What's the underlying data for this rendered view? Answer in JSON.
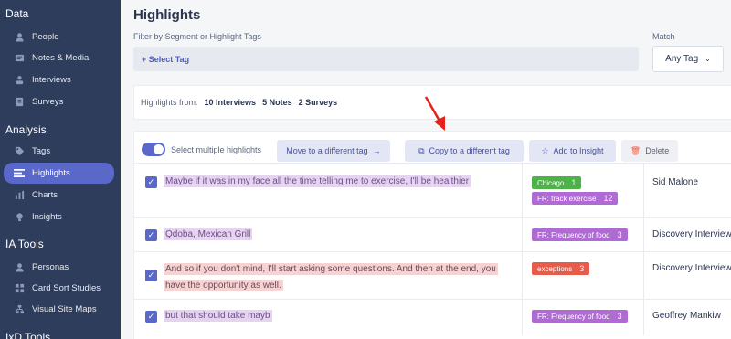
{
  "sidebar": {
    "sections": [
      {
        "title": "Data",
        "items": [
          {
            "label": "People",
            "icon": "people-icon"
          },
          {
            "label": "Notes & Media",
            "icon": "notes-icon"
          },
          {
            "label": "Interviews",
            "icon": "interviews-icon"
          },
          {
            "label": "Surveys",
            "icon": "surveys-icon"
          }
        ]
      },
      {
        "title": "Analysis",
        "items": [
          {
            "label": "Tags",
            "icon": "tag-icon"
          },
          {
            "label": "Highlights",
            "icon": "highlights-icon",
            "active": true
          },
          {
            "label": "Charts",
            "icon": "chart-icon"
          },
          {
            "label": "Insights",
            "icon": "bulb-icon"
          }
        ]
      },
      {
        "title": "IA Tools",
        "items": [
          {
            "label": "Personas",
            "icon": "persona-icon"
          },
          {
            "label": "Card Sort Studies",
            "icon": "card-sort-icon"
          },
          {
            "label": "Visual Site Maps",
            "icon": "sitemap-icon"
          }
        ]
      },
      {
        "title": "IxD Tools",
        "items": []
      }
    ]
  },
  "main": {
    "title": "Highlights",
    "filter_label": "Filter by Segment or Highlight Tags",
    "select_tag": "+ Select Tag",
    "match_label": "Match",
    "match_value": "Any Tag",
    "highlights_from": {
      "label": "Highlights from:",
      "interviews": "10 Interviews",
      "notes": "5 Notes",
      "surveys": "2 Surveys"
    },
    "toolbar": {
      "toggle_label": "Select multiple highlights",
      "move": "Move to a different tag",
      "copy": "Copy to a different tag",
      "add_insight": "Add to Insight",
      "delete": "Delete"
    },
    "rows": [
      {
        "text": "Maybe if it was in my face all the time telling me to exercise, I'll be healthier",
        "style": "purple",
        "tags": [
          {
            "label": "Chicago",
            "count": "1",
            "color": "green"
          },
          {
            "label": "FR: track exercise",
            "count": "12",
            "color": "purple"
          }
        ],
        "source": "Sid Malone"
      },
      {
        "text": "Qdoba, Mexican Grill",
        "style": "purple",
        "tags": [
          {
            "label": "FR: Frequency of food",
            "count": "3",
            "color": "purple"
          }
        ],
        "source": "Discovery Interview"
      },
      {
        "text": "And so if you don't mind, I'll start asking some questions. And then at the end, you have the opportunity as well.",
        "style": "red",
        "tags": [
          {
            "label": "exceptions",
            "count": "3",
            "color": "red"
          }
        ],
        "source": "Discovery Interview"
      },
      {
        "text": "but that should take mayb",
        "style": "purple",
        "tags": [
          {
            "label": "FR: Frequency of food",
            "count": "3",
            "color": "purple"
          }
        ],
        "source": "Geoffrey Mankiw"
      }
    ]
  },
  "colors": {
    "sidebar_bg": "#2f3d5c",
    "accent": "#5968c9",
    "annotation_arrow": "#e8201a"
  }
}
